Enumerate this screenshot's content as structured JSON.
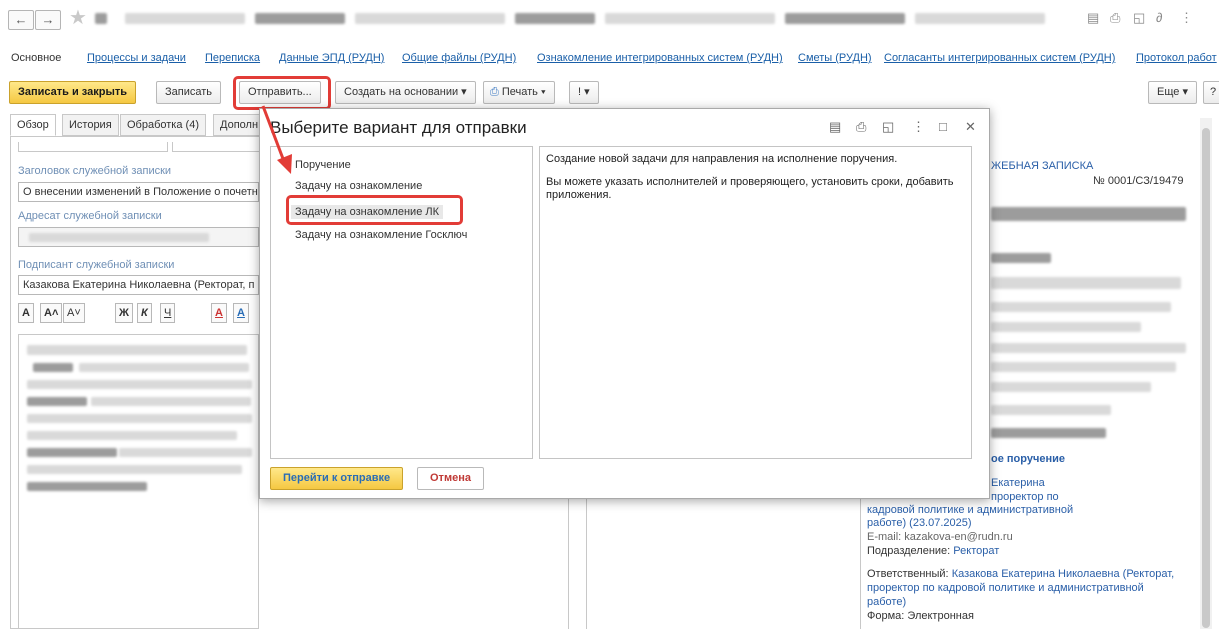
{
  "titlebar": {
    "back": "←",
    "forward": "→"
  },
  "nav_tabs": [
    {
      "label": "Основное",
      "active": true
    },
    {
      "label": "Процессы и задачи"
    },
    {
      "label": "Переписка"
    },
    {
      "label": "Данные ЭПД (РУДН)"
    },
    {
      "label": "Общие файлы (РУДН)"
    },
    {
      "label": "Ознакомление интегрированных систем (РУДН)"
    },
    {
      "label": "Сметы (РУДН)"
    },
    {
      "label": "Согласанты интегрированных систем (РУДН)"
    },
    {
      "label": "Протокол работ"
    }
  ],
  "toolbar": {
    "save_close": "Записать и закрыть",
    "save": "Записать",
    "send": "Отправить...",
    "create_based": "Создать на основании ▾",
    "print": "Печать ▾",
    "importance": "! ▾",
    "more": "Еще ▾",
    "help": "?"
  },
  "form_tabs": [
    "Обзор",
    "История",
    "Обработка (4)",
    "Дополн"
  ],
  "form": {
    "title_label": "Заголовок служебной записки",
    "title_value": "О внесении изменений в Положение о почетн",
    "addressee_label": "Адресат служебной записки",
    "signer_label": "Подписант служебной записки",
    "signer_value": "Казакова Екатерина Николаевна (Ректорат, п",
    "fmt_buttons": [
      "A",
      "A˄",
      "A˅",
      "Ж",
      "К",
      "Ч",
      "A",
      "A"
    ]
  },
  "dialog": {
    "title": "Выберите вариант для отправки",
    "items": [
      "Поручение",
      "Задачу на ознакомление",
      "Задачу на ознакомление ЛК",
      "Задачу на ознакомление Госключ"
    ],
    "selected_index": 2,
    "description_1": "Создание новой задачи для направления на исполнение поручения.",
    "description_2": "Вы можете указать исполнителей и проверяющего, установить сроки, добавить приложения.",
    "go_button": "Перейти к отправке",
    "cancel_button": "Отмена"
  },
  "preview": {
    "heading": "ЖЕБНАЯ ЗАПИСКА",
    "number": "№ 0001/СЗ/19479",
    "section": "ое поручение",
    "l1": "Екатерина",
    "l2": "проректор по",
    "l3": "кадровой политике и административной",
    "l4": "работе) (23.07.2025)",
    "email_label": "E-mail:",
    "email": "kazakova-en@rudn.ru",
    "dept_label": "Подразделение:",
    "dept": "Ректорат",
    "resp_label": "Ответственный:",
    "resp_1": "Казакова Екатерина Николаевна (Ректорат,",
    "resp_2": "проректор по кадровой политике и административной",
    "resp_3": "работе)",
    "form_label": "Форма:",
    "form_value": "Электронная"
  },
  "colors": {
    "accent_red": "#e23c37",
    "link_blue": "#1a5fa8",
    "primary_yellow": "#f5c842"
  }
}
